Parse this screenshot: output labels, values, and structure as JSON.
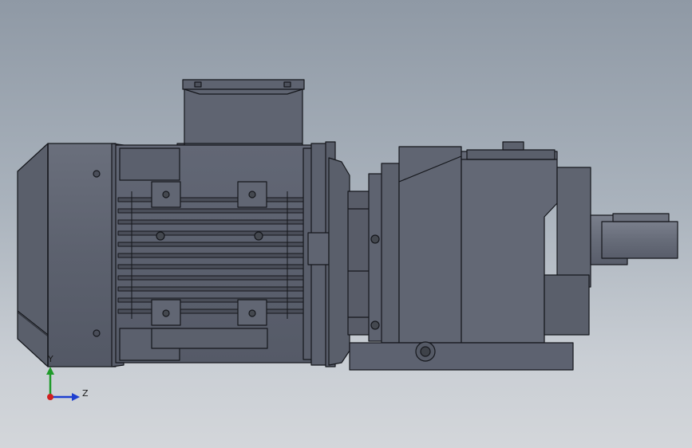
{
  "viewport": {
    "background_top": "#8f99a5",
    "background_bottom": "#d3d6da",
    "model_color": "#5d6270",
    "edge_color": "#15171c"
  },
  "triad": {
    "y_label": "Y",
    "z_label": "Z",
    "y_color": "#1f9a2a",
    "z_color": "#1e3fd0",
    "x_color": "#d02020"
  }
}
